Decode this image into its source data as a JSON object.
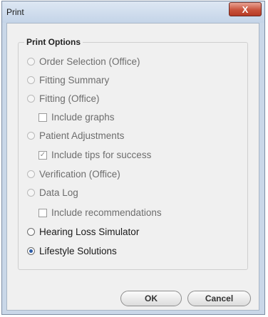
{
  "window": {
    "title": "Print",
    "close_glyph": "X"
  },
  "group": {
    "label": "Print Options"
  },
  "options": [
    {
      "type": "radio",
      "label": "Order Selection (Office)",
      "enabled": false,
      "checked": false
    },
    {
      "type": "radio",
      "label": "Fitting Summary",
      "enabled": false,
      "checked": false
    },
    {
      "type": "radio",
      "label": "Fitting (Office)",
      "enabled": false,
      "checked": false
    },
    {
      "type": "checkbox",
      "label": "Include graphs",
      "enabled": false,
      "checked": false
    },
    {
      "type": "radio",
      "label": "Patient Adjustments",
      "enabled": false,
      "checked": false
    },
    {
      "type": "checkbox",
      "label": "Include tips for success",
      "enabled": false,
      "checked": true
    },
    {
      "type": "radio",
      "label": "Verification (Office)",
      "enabled": false,
      "checked": false
    },
    {
      "type": "radio",
      "label": "Data Log",
      "enabled": false,
      "checked": false
    },
    {
      "type": "checkbox",
      "label": "Include recommendations",
      "enabled": false,
      "checked": false
    },
    {
      "type": "radio",
      "label": "Hearing Loss Simulator",
      "enabled": true,
      "checked": false
    },
    {
      "type": "radio",
      "label": "Lifestyle Solutions",
      "enabled": true,
      "checked": true
    }
  ],
  "buttons": {
    "ok": "OK",
    "cancel": "Cancel"
  }
}
